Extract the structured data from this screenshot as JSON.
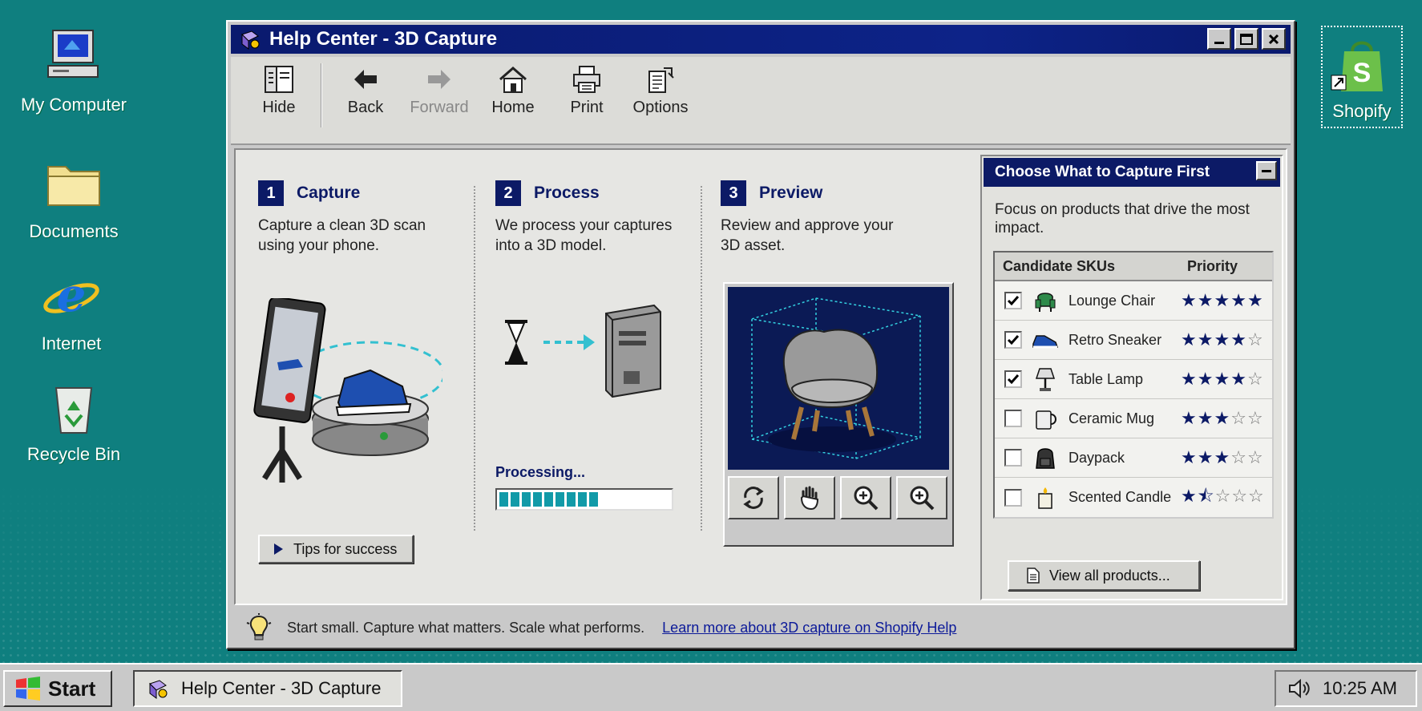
{
  "desktop": {
    "icons": [
      {
        "label": "My Computer"
      },
      {
        "label": "Documents"
      },
      {
        "label": "Internet"
      },
      {
        "label": "Recycle Bin"
      },
      {
        "label": "Shopify"
      }
    ]
  },
  "window": {
    "title": "Help Center - 3D Capture",
    "toolbar": {
      "hide": "Hide",
      "back": "Back",
      "forward": "Forward",
      "home": "Home",
      "print": "Print",
      "options": "Options"
    }
  },
  "steps": [
    {
      "num": "1",
      "title": "Capture",
      "desc": "Capture a clean 3D scan using your phone."
    },
    {
      "num": "2",
      "title": "Process",
      "desc": "We process your captures into a 3D model."
    },
    {
      "num": "3",
      "title": "Preview",
      "desc": "Review and approve your 3D asset."
    }
  ],
  "tips_button": "Tips for success",
  "processing": {
    "label": "Processing...",
    "progress_fraction": 0.6
  },
  "preview_controls": [
    "rotate",
    "pan",
    "zoom-in",
    "zoom-out"
  ],
  "panel": {
    "title": "Choose What to Capture First",
    "desc": "Focus on products that drive the most impact.",
    "col_sku": "Candidate SKUs",
    "col_priority": "Priority",
    "rows": [
      {
        "name": "Lounge Chair",
        "checked": true,
        "stars": 5,
        "half": false,
        "icon": "chair-icon"
      },
      {
        "name": "Retro Sneaker",
        "checked": true,
        "stars": 4,
        "half": false,
        "icon": "sneaker-icon"
      },
      {
        "name": "Table Lamp",
        "checked": true,
        "stars": 4,
        "half": false,
        "icon": "lamp-icon"
      },
      {
        "name": "Ceramic Mug",
        "checked": false,
        "stars": 3,
        "half": false,
        "icon": "mug-icon"
      },
      {
        "name": "Daypack",
        "checked": false,
        "stars": 3,
        "half": false,
        "icon": "backpack-icon"
      },
      {
        "name": "Scented Candle",
        "checked": false,
        "stars": 1,
        "half": true,
        "icon": "candle-icon"
      }
    ],
    "view_all": "View all products..."
  },
  "status": {
    "tip": "Start small. Capture what matters. Scale what performs.",
    "link": "Learn more about 3D capture on Shopify Help"
  },
  "taskbar": {
    "start": "Start",
    "task": "Help Center - 3D Capture",
    "time": "10:25 AM"
  },
  "colors": {
    "desktop": "#0f7f7f",
    "titlebar": "#0a1a6e",
    "accent": "#119aa8"
  }
}
